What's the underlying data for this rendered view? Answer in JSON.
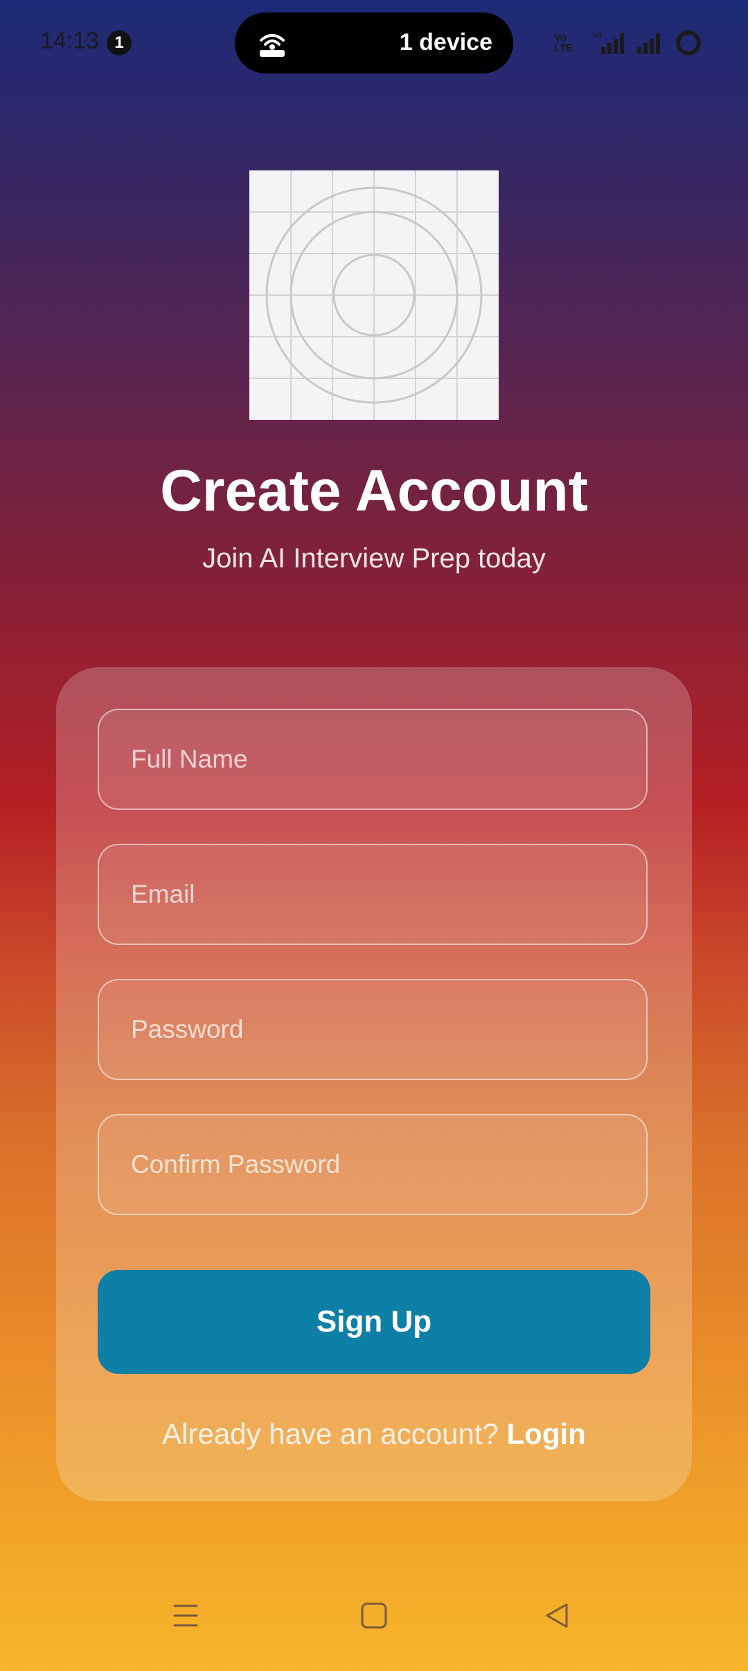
{
  "status_bar": {
    "time": "14:13",
    "notification_count": "1",
    "hotspot_label": "1 device",
    "network_label": "Vo LTE",
    "network_gen": "5G"
  },
  "logo": {
    "icon": "placeholder-logo-grid"
  },
  "header": {
    "title": "Create Account",
    "subtitle": "Join AI Interview Prep today"
  },
  "form": {
    "full_name_placeholder": "Full Name",
    "email_placeholder": "Email",
    "password_placeholder": "Password",
    "confirm_password_placeholder": "Confirm Password",
    "submit_label": "Sign Up",
    "login_prompt": "Already have an account?",
    "login_link": "Login"
  },
  "nav_bar": {
    "icons": [
      "menu-icon",
      "home-icon",
      "back-icon"
    ]
  },
  "colors": {
    "primary_button": "#0e7fa6",
    "gradient_top": "#1c2a78",
    "gradient_mid": "#b41f24",
    "gradient_bottom": "#f7b62c"
  }
}
